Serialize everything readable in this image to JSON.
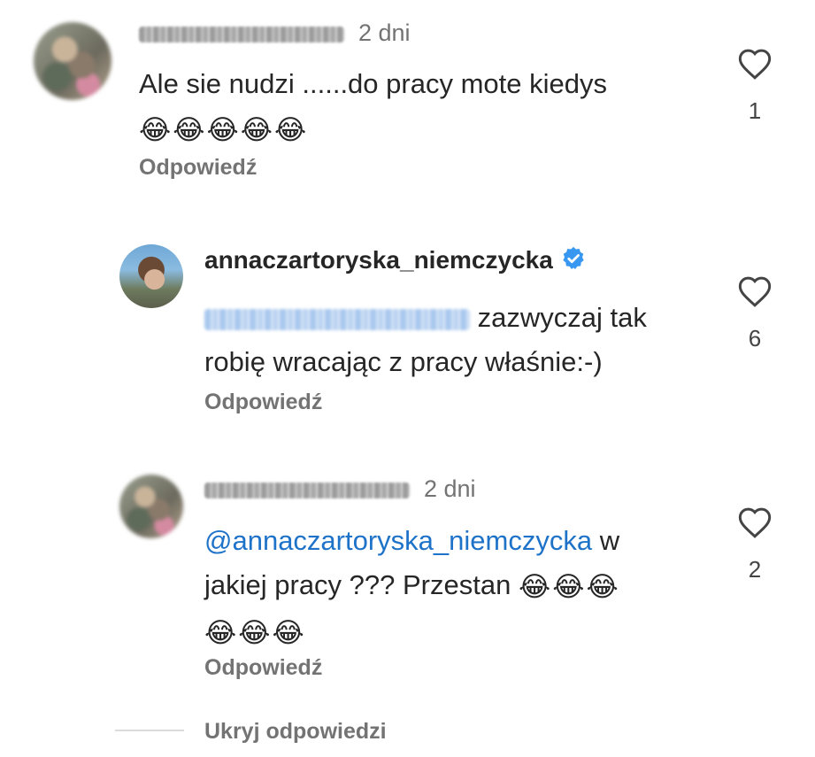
{
  "comments": [
    {
      "time": "2 dni",
      "text": "Ale sie nudzi ......do pracy mote kiedys",
      "emoji": [
        "😂",
        "😂",
        "😂",
        "😂",
        "😂"
      ],
      "reply_label": "Odpowiedź",
      "likes": "1"
    },
    {
      "username": "annaczartoryska_niemczycka",
      "text_line1": "zazwyczaj tak",
      "text_line2": "robię wracając z pracy właśnie:-)",
      "reply_label": "Odpowiedź",
      "likes": "6"
    },
    {
      "time": "2 dni",
      "mention": "@annaczartoryska_niemczycka",
      "text_line1_tail": "w",
      "text_line2": "jakiej pracy ??? Przestan",
      "emoji_line2": [
        "😂",
        "😂",
        "😂"
      ],
      "emoji_line3": [
        "😂",
        "😂",
        "😂"
      ],
      "reply_label": "Odpowiedź",
      "likes": "2"
    }
  ],
  "hide_replies_label": "Ukryj odpowiedzi",
  "colors": {
    "text": "#262626",
    "muted": "#737373",
    "mention": "#1e73c9",
    "verified": "#3897f0"
  }
}
